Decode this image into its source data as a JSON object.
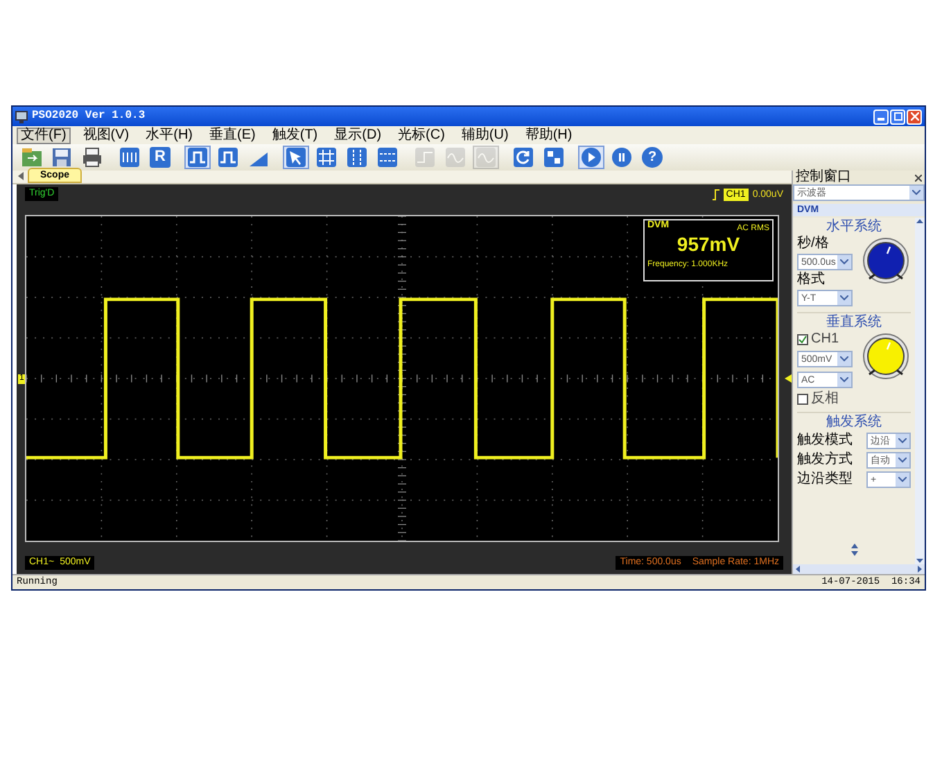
{
  "window": {
    "title": "PSO2020 Ver 1.0.3"
  },
  "menu": [
    {
      "label": "文件(F)",
      "selected": true
    },
    {
      "label": "视图(V)",
      "selected": false
    },
    {
      "label": "水平(H)",
      "selected": false
    },
    {
      "label": "垂直(E)",
      "selected": false
    },
    {
      "label": "触发(T)",
      "selected": false
    },
    {
      "label": "显示(D)",
      "selected": false
    },
    {
      "label": "光标(C)",
      "selected": false
    },
    {
      "label": "辅助(U)",
      "selected": false
    },
    {
      "label": "帮助(H)",
      "selected": false
    }
  ],
  "toolbar": [
    {
      "kind": "open",
      "disabled": false,
      "pressed": false
    },
    {
      "kind": "save",
      "disabled": false,
      "pressed": false
    },
    {
      "kind": "print",
      "disabled": false,
      "pressed": false
    },
    {
      "kind": "measure",
      "disabled": false,
      "pressed": false
    },
    {
      "kind": "letter",
      "label": "R",
      "disabled": false,
      "pressed": false
    },
    {
      "kind": "pulse",
      "disabled": false,
      "pressed": true
    },
    {
      "kind": "pulse",
      "disabled": false,
      "pressed": false
    },
    {
      "kind": "ramp",
      "disabled": false,
      "pressed": false
    },
    {
      "kind": "cursor",
      "disabled": false,
      "pressed": true
    },
    {
      "kind": "grid",
      "disabled": false,
      "pressed": false
    },
    {
      "kind": "vlines",
      "disabled": false,
      "pressed": false
    },
    {
      "kind": "hlines",
      "disabled": false,
      "pressed": false
    },
    {
      "kind": "step",
      "disabled": true,
      "pressed": false
    },
    {
      "kind": "wave",
      "disabled": true,
      "pressed": false
    },
    {
      "kind": "wave",
      "disabled": true,
      "pressed": true
    },
    {
      "kind": "refresh",
      "disabled": false,
      "pressed": false
    },
    {
      "kind": "zoom",
      "disabled": false,
      "pressed": false
    },
    {
      "kind": "run",
      "disabled": false,
      "pressed": true
    },
    {
      "kind": "pause",
      "disabled": false,
      "pressed": false
    },
    {
      "kind": "letter-round",
      "label": "?",
      "disabled": false,
      "pressed": false
    }
  ],
  "tabs": [
    {
      "label": "Scope",
      "selected": true
    }
  ],
  "scope": {
    "trigger_status": "Trig'D",
    "trigger_channel": "CH1",
    "trigger_level": "0.00uV",
    "channel_marker": "1",
    "dvm": {
      "title": "DVM",
      "mode": "AC RMS",
      "reading": "957mV",
      "frequency": "Frequency: 1.000KHz"
    },
    "channel_name": "CH1~",
    "channel_scale": "500mV",
    "time": "Time: 500.0us",
    "sample_rate": "Sample Rate: 1MHz"
  },
  "control_panel": {
    "title": "控制窗口",
    "mode": "示波器",
    "tab": "DVM",
    "horizontal": {
      "title": "水平系统",
      "timebase_label": "秒/格",
      "timebase": "500.0us",
      "format_label": "格式",
      "format": "Y-T"
    },
    "vertical": {
      "title": "垂直系统",
      "channel": {
        "label": "CH1",
        "checked": true
      },
      "scale": "500mV",
      "coupling": "AC",
      "invert": {
        "label": "反相",
        "checked": false
      }
    },
    "trigger": {
      "title": "触发系统",
      "rows": [
        {
          "label": "触发模式",
          "value": "边沿"
        },
        {
          "label": "触发方式",
          "value": "自动"
        },
        {
          "label": "边沿类型",
          "value": "+"
        }
      ]
    }
  },
  "status_bar": {
    "status": "Running",
    "datetime": "14-07-2015  16:34"
  }
}
